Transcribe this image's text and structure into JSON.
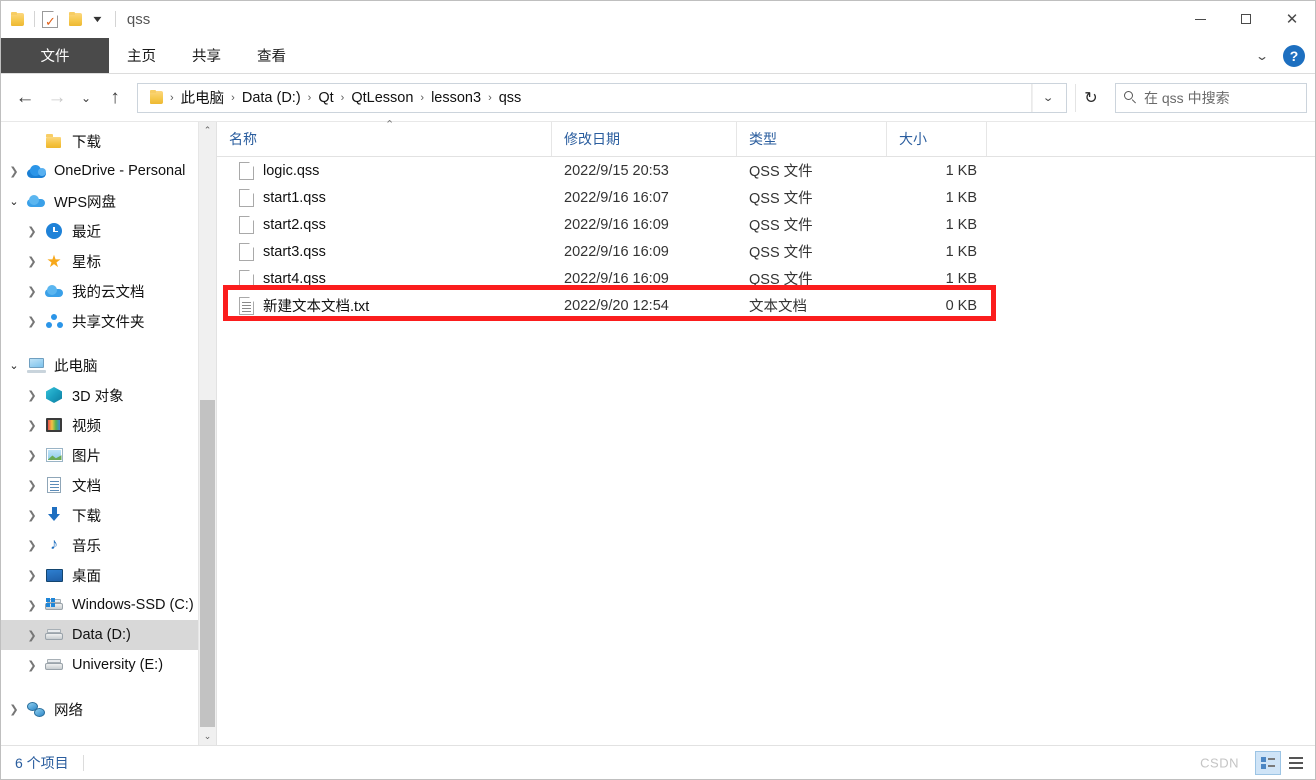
{
  "window": {
    "title": "qss",
    "quick_access": [
      {
        "name": "folder-icon",
        "label": "qss"
      },
      {
        "name": "properties-icon",
        "label": "属性"
      },
      {
        "name": "new-folder-icon",
        "label": "新建文件夹"
      },
      {
        "name": "customize-caret-icon",
        "label": "自定义快速访问工具栏"
      }
    ],
    "controls": {
      "minimize": "—",
      "maximize": "□",
      "close": "✕"
    }
  },
  "ribbon": {
    "tabs": [
      {
        "label": "文件",
        "active": true
      },
      {
        "label": "主页",
        "active": false
      },
      {
        "label": "共享",
        "active": false
      },
      {
        "label": "查看",
        "active": false
      }
    ],
    "expand_caret": "⌄",
    "help_label": "?"
  },
  "navigation": {
    "back": "←",
    "forward": "→",
    "recent_caret": "⌄",
    "up": "↑",
    "refresh": "↻",
    "address_dropdown": "⌄",
    "breadcrumb": [
      "此电脑",
      "Data (D:)",
      "Qt",
      "QtLesson",
      "lesson3",
      "qss"
    ],
    "breadcrumb_separator": "›"
  },
  "search": {
    "placeholder": "在 qss 中搜索",
    "icon": "search-icon"
  },
  "sidebar": {
    "items": [
      {
        "label": "下载",
        "level": 2,
        "icon": "folder-icon",
        "twisty": "none",
        "selected": false
      },
      {
        "label": "OneDrive - Personal",
        "level": 1,
        "icon": "onedrive-cloud-icon",
        "twisty": "collapsed",
        "selected": false
      },
      {
        "label": "WPS网盘",
        "level": 1,
        "icon": "wps-cloud-icon",
        "twisty": "expanded",
        "selected": false
      },
      {
        "label": "最近",
        "level": 2,
        "icon": "clock-icon",
        "twisty": "collapsed",
        "selected": false
      },
      {
        "label": "星标",
        "level": 2,
        "icon": "star-icon",
        "twisty": "collapsed",
        "selected": false
      },
      {
        "label": "我的云文档",
        "level": 2,
        "icon": "cloud-doc-icon",
        "twisty": "collapsed",
        "selected": false
      },
      {
        "label": "共享文件夹",
        "level": 2,
        "icon": "share-folder-icon",
        "twisty": "collapsed",
        "selected": false
      },
      {
        "label": "此电脑",
        "level": 1,
        "icon": "this-pc-icon",
        "twisty": "expanded",
        "selected": false
      },
      {
        "label": "3D 对象",
        "level": 2,
        "icon": "3d-objects-icon",
        "twisty": "collapsed",
        "selected": false
      },
      {
        "label": "视频",
        "level": 2,
        "icon": "videos-icon",
        "twisty": "collapsed",
        "selected": false
      },
      {
        "label": "图片",
        "level": 2,
        "icon": "pictures-icon",
        "twisty": "collapsed",
        "selected": false
      },
      {
        "label": "文档",
        "level": 2,
        "icon": "documents-icon",
        "twisty": "collapsed",
        "selected": false
      },
      {
        "label": "下载",
        "level": 2,
        "icon": "downloads-icon",
        "twisty": "collapsed",
        "selected": false
      },
      {
        "label": "音乐",
        "level": 2,
        "icon": "music-icon",
        "twisty": "collapsed",
        "selected": false
      },
      {
        "label": "桌面",
        "level": 2,
        "icon": "desktop-icon",
        "twisty": "collapsed",
        "selected": false
      },
      {
        "label": "Windows-SSD (C:)",
        "level": 2,
        "icon": "system-drive-icon",
        "twisty": "collapsed",
        "selected": false
      },
      {
        "label": "Data (D:)",
        "level": 2,
        "icon": "drive-icon",
        "twisty": "collapsed",
        "selected": true
      },
      {
        "label": "University (E:)",
        "level": 2,
        "icon": "drive-icon",
        "twisty": "collapsed",
        "selected": false
      },
      {
        "label": "网络",
        "level": 1,
        "icon": "network-icon",
        "twisty": "collapsed",
        "selected": false
      }
    ]
  },
  "filelist": {
    "columns": [
      {
        "key": "name",
        "label": "名称"
      },
      {
        "key": "date",
        "label": "修改日期"
      },
      {
        "key": "type",
        "label": "类型"
      },
      {
        "key": "size",
        "label": "大小"
      }
    ],
    "sort": {
      "column": "名称",
      "direction": "asc",
      "caret": "⌃"
    },
    "rows": [
      {
        "name": "logic.qss",
        "date": "2022/9/15 20:53",
        "type": "QSS 文件",
        "size": "1 KB",
        "icon": "qss-file-icon"
      },
      {
        "name": "start1.qss",
        "date": "2022/9/16 16:07",
        "type": "QSS 文件",
        "size": "1 KB",
        "icon": "qss-file-icon"
      },
      {
        "name": "start2.qss",
        "date": "2022/9/16 16:09",
        "type": "QSS 文件",
        "size": "1 KB",
        "icon": "qss-file-icon"
      },
      {
        "name": "start3.qss",
        "date": "2022/9/16 16:09",
        "type": "QSS 文件",
        "size": "1 KB",
        "icon": "qss-file-icon"
      },
      {
        "name": "start4.qss",
        "date": "2022/9/16 16:09",
        "type": "QSS 文件",
        "size": "1 KB",
        "icon": "qss-file-icon"
      },
      {
        "name": "新建文本文档.txt",
        "date": "2022/9/20 12:54",
        "type": "文本文档",
        "size": "0 KB",
        "icon": "text-file-icon"
      }
    ],
    "annotation": {
      "color": "#fb1d1d",
      "target_row": "新建文本文档.txt"
    }
  },
  "statusbar": {
    "item_count": "6 个项目",
    "watermark": "CSDN",
    "views": [
      {
        "name": "details-view",
        "active": false
      },
      {
        "name": "large-icons-view",
        "active": true
      }
    ]
  },
  "colors": {
    "accent": "#2a5d9e",
    "annotation_red": "#fb1d1d",
    "file_tab_bg": "#4a4a4a",
    "selection_gray": "#d8d8d8",
    "help_blue": "#1d6fc0"
  }
}
